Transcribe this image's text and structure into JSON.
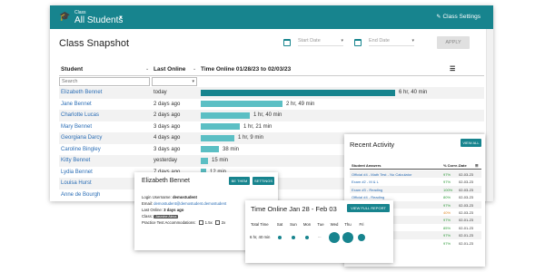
{
  "header": {
    "class_label": "Class",
    "class_name": "All Students",
    "settings_label": "Class Settings",
    "bg_color": "#17848e"
  },
  "page_title": "Class Snapshot",
  "date_filter": {
    "start_placeholder": "Start Date",
    "end_placeholder": "End Date",
    "apply_label": "APPLY"
  },
  "table": {
    "columns": {
      "student": "Student",
      "last_online": "Last Online",
      "time_online": "Time Online 01/28/23 to 02/03/23"
    },
    "search_placeholder": "Search",
    "rows": [
      {
        "name": "Elizabeth Bennet",
        "last_online": "today",
        "time": "6 hr, 40 min",
        "minutes": 400
      },
      {
        "name": "Jane Bennet",
        "last_online": "2 days ago",
        "time": "2 hr, 49 min",
        "minutes": 169
      },
      {
        "name": "Charlotte Lucas",
        "last_online": "2 days ago",
        "time": "1 hr, 40 min",
        "minutes": 100
      },
      {
        "name": "Mary Bennet",
        "last_online": "3 days ago",
        "time": "1 hr, 21 min",
        "minutes": 81
      },
      {
        "name": "Georgiana Darcy",
        "last_online": "4 days ago",
        "time": "1 hr, 9 min",
        "minutes": 69
      },
      {
        "name": "Caroline Bingley",
        "last_online": "3 days ago",
        "time": "38 min",
        "minutes": 38
      },
      {
        "name": "Kitty Bennet",
        "last_online": "yesterday",
        "time": "15 min",
        "minutes": 15
      },
      {
        "name": "Lydia Bennet",
        "last_online": "7 days ago",
        "time": "12 min",
        "minutes": 12
      },
      {
        "name": "Louisa Hurst",
        "last_online": "",
        "time": "",
        "minutes": 0
      },
      {
        "name": "Anne de Bourgh",
        "last_online": "",
        "time": "",
        "minutes": 0
      }
    ],
    "bar_color": "#5bbfc4",
    "bar_color_top": "#17848e"
  },
  "student_card": {
    "title": "Elizabeth Bennet",
    "be_them_label": "BE THEM",
    "settings_label": "SETTINGS",
    "username_label": "Login Username:",
    "username": "demostudent",
    "email_label": "Email:",
    "email": "demostudent@demostudent.demostudent",
    "last_online_label": "Last Online:",
    "last_online": "3 days ago",
    "class_label": "Class:",
    "class_badge": "Jasmine Alexa",
    "accommodations_label": "Practice Test Accommodations:",
    "opt1": "1.5x",
    "opt2": "2x"
  },
  "recent_activity": {
    "title": "Recent Activity",
    "view_all_label": "VIEW ALL",
    "columns": {
      "answers": "Student Answers",
      "pct": "% Corre...",
      "date": "Date"
    },
    "rows": [
      {
        "answers": "Official #4 - Math Test - No Calculator",
        "pct": "97%",
        "date": "02-03-23",
        "color": "green"
      },
      {
        "answers": "Exam #2 - M & L",
        "pct": "97%",
        "date": "02-03-23",
        "color": "green"
      },
      {
        "answers": "Exam #3 - Reading",
        "pct": "100%",
        "date": "02-03-23",
        "color": "green"
      },
      {
        "answers": "Official #4 - Reading",
        "pct": "80%",
        "date": "02-03-23",
        "color": "green"
      },
      {
        "answers": "",
        "pct": "97%",
        "date": "02-03-23",
        "color": "green"
      },
      {
        "answers": "",
        "pct": "40%",
        "date": "02-03-23",
        "color": "orange"
      },
      {
        "answers": "",
        "pct": "97%",
        "date": "02-01-23",
        "color": "green"
      },
      {
        "answers": "",
        "pct": "85%",
        "date": "02-01-23",
        "color": "green"
      },
      {
        "answers": "",
        "pct": "97%",
        "date": "02-01-23",
        "color": "green"
      },
      {
        "answers": "",
        "pct": "97%",
        "date": "02-01-23",
        "color": "green"
      }
    ]
  },
  "time_card": {
    "title": "Time Online Jan 28 - Feb 03",
    "view_report_label": "VIEW FULL REPORT",
    "total_label": "Total Time",
    "total_value": "6 hr, 40 min",
    "days": [
      {
        "label": "Sat",
        "level": 0.2
      },
      {
        "label": "Sun",
        "level": 0.2
      },
      {
        "label": "Mon",
        "level": 0.2
      },
      {
        "label": "Tue",
        "level": 0
      },
      {
        "label": "Wed",
        "level": 1.0
      },
      {
        "label": "Thu",
        "level": 1.0
      },
      {
        "label": "Fri",
        "level": 0.55
      }
    ],
    "empty_mark": "..."
  }
}
